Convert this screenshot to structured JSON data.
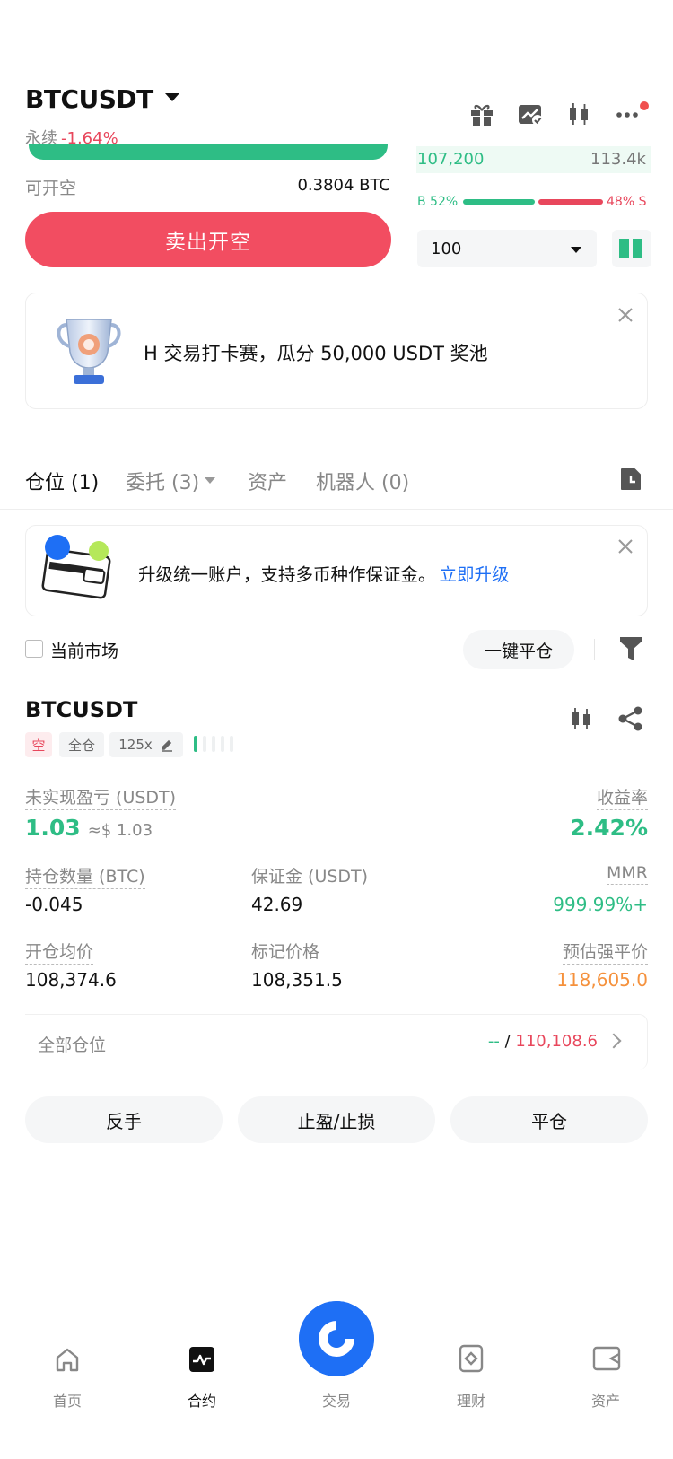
{
  "header": {
    "symbol": "BTCUSDT",
    "contract_type": "永续",
    "change": "-1.64%",
    "icons": [
      "gift-icon",
      "exchange-icon",
      "candlestick-icon",
      "more-icon"
    ]
  },
  "trade_panel": {
    "available_label": "可开空",
    "available_value": "0.3804 BTC",
    "sell_button": "卖出开空"
  },
  "order_book": {
    "price": "107,200",
    "size": "113.4k",
    "buy_ratio": "B 52%",
    "sell_ratio": "48% S",
    "buy_ratio_value": 0.52,
    "depth_value": "100"
  },
  "promo_banner": {
    "text": "H 交易打卡赛，瓜分 50,000 USDT 奖池"
  },
  "tabs": [
    {
      "label": "仓位 (1)"
    },
    {
      "label": "委托 (3)"
    },
    {
      "label": "资产"
    },
    {
      "label": "机器人 (0)"
    }
  ],
  "upgrade_banner": {
    "text": "升级统一账户，支持多币种作保证金。",
    "link": "立即升级"
  },
  "filter_bar": {
    "current_market": "当前市场",
    "close_all": "一键平仓"
  },
  "position": {
    "symbol": "BTCUSDT",
    "side": "空",
    "margin_mode": "全仓",
    "leverage": "125x",
    "unrealized_pnl_label": "未实现盈亏 (USDT)",
    "unrealized_pnl": "1.03",
    "unrealized_pnl_usd": "≈$ 1.03",
    "roe_label": "收益率",
    "roe": "2.42%",
    "size_label": "持仓数量 (BTC)",
    "size": "-0.045",
    "margin_label": "保证金 (USDT)",
    "margin": "42.69",
    "mmr_label": "MMR",
    "mmr": "999.99%+",
    "entry_label": "开仓均价",
    "entry": "108,374.6",
    "mark_label": "标记价格",
    "mark": "108,351.5",
    "liq_label": "预估强平价",
    "liq": "118,605.0"
  },
  "all_positions": {
    "label": "全部仓位",
    "dash": "--",
    "sep": " / ",
    "value": "110,108.6"
  },
  "actions": {
    "reverse": "反手",
    "tp_sl": "止盈/止损",
    "close": "平仓"
  },
  "bottom_nav": [
    {
      "label": "首页",
      "icon": "home-icon"
    },
    {
      "label": "合约",
      "icon": "futures-icon"
    },
    {
      "label": "交易",
      "icon": "trade-icon"
    },
    {
      "label": "理财",
      "icon": "earn-icon"
    },
    {
      "label": "资产",
      "icon": "wallet-icon"
    }
  ],
  "colors": {
    "green": "#2ebd85",
    "red": "#e8475c",
    "blue": "#1e6ff5",
    "orange": "#f5913c"
  }
}
